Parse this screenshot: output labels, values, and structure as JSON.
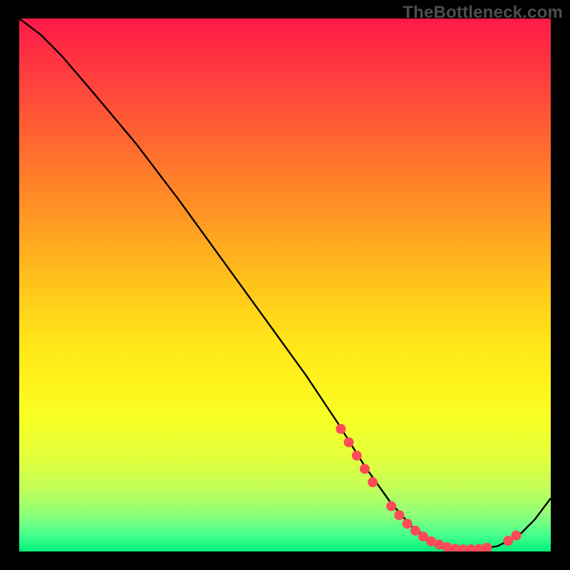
{
  "watermark": "TheBottleneck.com",
  "chart_data": {
    "type": "line",
    "title": "",
    "xlabel": "",
    "ylabel": "",
    "xlim": [
      0,
      100
    ],
    "ylim": [
      0,
      100
    ],
    "grid": false,
    "legend": false,
    "series": [
      {
        "name": "curve",
        "stroke": "#000000",
        "x": [
          0,
          4,
          8,
          14,
          22,
          30,
          38,
          46,
          54,
          60,
          65,
          70,
          74,
          78,
          82,
          86,
          90,
          94,
          97,
          100
        ],
        "y": [
          100,
          97,
          93,
          86,
          76.5,
          66,
          55,
          44,
          33,
          24,
          16,
          9,
          4.5,
          1.8,
          0.6,
          0.4,
          1.0,
          3.0,
          6.0,
          10
        ]
      }
    ],
    "markers": [
      {
        "x": 60.5,
        "y": 23.0,
        "color": "#ff4a58"
      },
      {
        "x": 62.0,
        "y": 20.5,
        "color": "#ff4a58"
      },
      {
        "x": 63.5,
        "y": 18.0,
        "color": "#ff4a58"
      },
      {
        "x": 65.0,
        "y": 15.5,
        "color": "#ff4a58"
      },
      {
        "x": 66.5,
        "y": 13.0,
        "color": "#ff4a58"
      },
      {
        "x": 70.0,
        "y": 8.5,
        "color": "#ff4a58"
      },
      {
        "x": 71.5,
        "y": 6.8,
        "color": "#ff4a58"
      },
      {
        "x": 73.0,
        "y": 5.2,
        "color": "#ff4a58"
      },
      {
        "x": 74.5,
        "y": 3.9,
        "color": "#ff4a58"
      },
      {
        "x": 76.0,
        "y": 2.8,
        "color": "#ff4a58"
      },
      {
        "x": 77.5,
        "y": 1.9,
        "color": "#ff4a58"
      },
      {
        "x": 79.0,
        "y": 1.3,
        "color": "#ff4a58"
      },
      {
        "x": 80.5,
        "y": 0.8,
        "color": "#ff4a58"
      },
      {
        "x": 82.0,
        "y": 0.5,
        "color": "#ff4a58"
      },
      {
        "x": 83.5,
        "y": 0.4,
        "color": "#ff4a58"
      },
      {
        "x": 85.0,
        "y": 0.4,
        "color": "#ff4a58"
      },
      {
        "x": 86.5,
        "y": 0.5,
        "color": "#ff4a58"
      },
      {
        "x": 88.0,
        "y": 0.7,
        "color": "#ff4a58"
      },
      {
        "x": 92.0,
        "y": 2.0,
        "color": "#ff4a58"
      },
      {
        "x": 93.5,
        "y": 3.0,
        "color": "#ff4a58"
      }
    ],
    "gradient_stops": [
      {
        "pos": 0,
        "color": "#ff1a49"
      },
      {
        "pos": 100,
        "color": "#00ee7a"
      }
    ]
  }
}
